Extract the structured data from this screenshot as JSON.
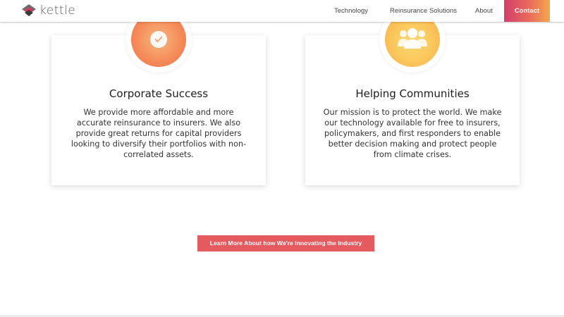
{
  "header": {
    "logo_text": "kettle",
    "logo_icon": "kettle-logo-icon",
    "nav": {
      "technology": "Technology",
      "reinsurance": "Reinsurance Solutions",
      "about": "About",
      "contact": "Contact"
    }
  },
  "cards": [
    {
      "icon": "check-icon",
      "title": "Corporate Success",
      "body": "We provide more affordable and more accurate reinsurance to insurers. We also provide great returns for capital providers looking to diversify their portfolios with non-correlated assets."
    },
    {
      "icon": "people-icon",
      "title": "Helping Communities",
      "body": "Our mission is to protect the world. We make our technology available for free to insurers, policymakers, and first responders to enable better decision making and protect people from climate crises."
    }
  ],
  "cta": {
    "label": "Learn More About how We're Innovating the Industry"
  },
  "colors": {
    "contact_gradient_start": "#d33f6a",
    "contact_gradient_end": "#f2a94b",
    "cta_background": "#e55a5f",
    "orange_circle": "#f58d5a",
    "yellow_circle": "#fbc95e"
  }
}
